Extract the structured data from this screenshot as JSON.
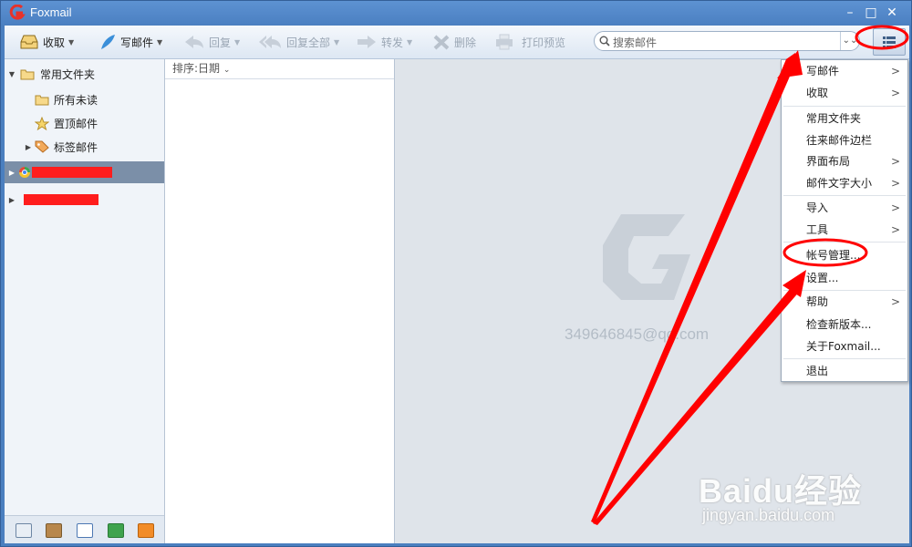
{
  "window": {
    "title": "Foxmail"
  },
  "toolbar": {
    "receive": "收取",
    "compose": "写邮件",
    "reply": "回复",
    "reply_all": "回复全部",
    "forward": "转发",
    "delete": "删除",
    "print_preview": "打印预览"
  },
  "search": {
    "placeholder": "搜索邮件"
  },
  "folders": {
    "common": "常用文件夹",
    "all_unread": "所有未读",
    "pinned": "置顶邮件",
    "tagged": "标签邮件"
  },
  "list": {
    "sort_label": "排序:日期"
  },
  "preview": {
    "account_email": "349646845@qq.com"
  },
  "menu": {
    "items": [
      "写邮件",
      "收取",
      "常用文件夹",
      "往来邮件边栏",
      "界面布局",
      "邮件文字大小",
      "导入",
      "工具",
      "帐号管理...",
      "设置...",
      "帮助",
      "检查新版本...",
      "关于Foxmail...",
      "退出"
    ]
  },
  "watermark": {
    "brand": "Baidu经验",
    "url": "jingyan.baidu.com"
  },
  "colors": {
    "titlebar": "#4b80c2",
    "selected": "#7b8fa8",
    "annotation": "#ff0000"
  },
  "icons": [
    "foxmail-logo-icon",
    "inbox-icon",
    "feather-icon",
    "reply-icon",
    "reply-all-icon",
    "forward-icon",
    "delete-icon",
    "printer-icon",
    "search-icon",
    "menu-list-icon",
    "folder-icon",
    "star-icon",
    "tag-icon",
    "account-icon"
  ]
}
